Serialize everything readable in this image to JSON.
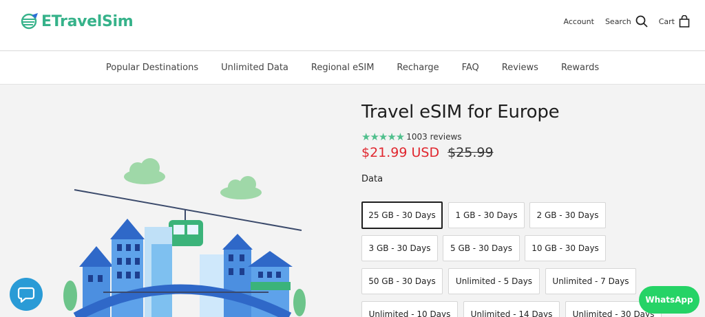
{
  "header": {
    "logo_text": "ETravelSim",
    "account_label": "Account",
    "search_label": "Search",
    "cart_label": "Cart"
  },
  "nav": {
    "items": [
      "Popular Destinations",
      "Unlimited Data",
      "Regional eSIM",
      "Recharge",
      "FAQ",
      "Reviews",
      "Rewards"
    ]
  },
  "product": {
    "title": "Travel eSIM for Europe",
    "stars": "★★★★★",
    "reviews": "1003 reviews",
    "price": "$21.99 USD",
    "old_price": "$25.99",
    "option_label": "Data",
    "options": [
      "25 GB - 30 Days",
      "1 GB - 30 Days",
      "2 GB - 30 Days",
      "3 GB - 30 Days",
      "5 GB - 30 Days",
      "10 GB - 30 Days",
      "50 GB - 30 Days",
      "Unlimited - 5 Days",
      "Unlimited - 7 Days",
      "Unlimited - 10 Days",
      "Unlimited - 14 Days",
      "Unlimited - 30 Days"
    ],
    "selected_option": "25 GB - 30 Days"
  },
  "widgets": {
    "whatsapp_label": "WhatsApp"
  },
  "colors": {
    "brand": "#36b28a",
    "price": "#e0262e",
    "chat": "#2a9bd6",
    "whatsapp": "#25d366"
  }
}
